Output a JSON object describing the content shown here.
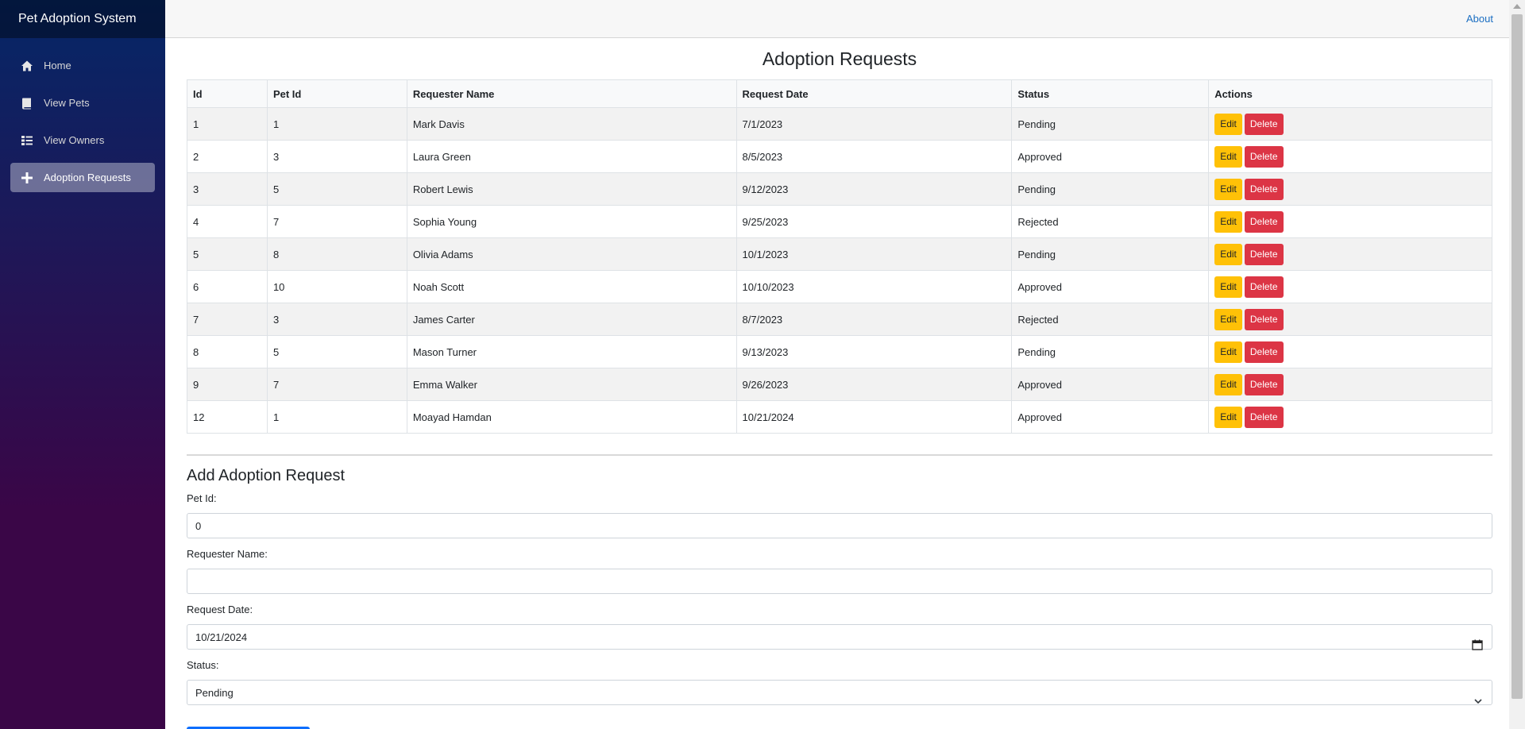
{
  "app": {
    "title": "Pet Adoption System"
  },
  "sidebar": {
    "items": [
      {
        "label": "Home",
        "icon": "home-icon"
      },
      {
        "label": "View Pets",
        "icon": "book-icon"
      },
      {
        "label": "View Owners",
        "icon": "list-icon"
      },
      {
        "label": "Adoption Requests",
        "icon": "plus-icon",
        "active": true
      }
    ]
  },
  "topbar": {
    "about": "About"
  },
  "page": {
    "title": "Adoption Requests"
  },
  "table": {
    "headers": [
      "Id",
      "Pet Id",
      "Requester Name",
      "Request Date",
      "Status",
      "Actions"
    ],
    "rows": [
      {
        "id": "1",
        "pet_id": "1",
        "name": "Mark Davis",
        "date": "7/1/2023",
        "status": "Pending"
      },
      {
        "id": "2",
        "pet_id": "3",
        "name": "Laura Green",
        "date": "8/5/2023",
        "status": "Approved"
      },
      {
        "id": "3",
        "pet_id": "5",
        "name": "Robert Lewis",
        "date": "9/12/2023",
        "status": "Pending"
      },
      {
        "id": "4",
        "pet_id": "7",
        "name": "Sophia Young",
        "date": "9/25/2023",
        "status": "Rejected"
      },
      {
        "id": "5",
        "pet_id": "8",
        "name": "Olivia Adams",
        "date": "10/1/2023",
        "status": "Pending"
      },
      {
        "id": "6",
        "pet_id": "10",
        "name": "Noah Scott",
        "date": "10/10/2023",
        "status": "Approved"
      },
      {
        "id": "7",
        "pet_id": "3",
        "name": "James Carter",
        "date": "8/7/2023",
        "status": "Rejected"
      },
      {
        "id": "8",
        "pet_id": "5",
        "name": "Mason Turner",
        "date": "9/13/2023",
        "status": "Pending"
      },
      {
        "id": "9",
        "pet_id": "7",
        "name": "Emma Walker",
        "date": "9/26/2023",
        "status": "Approved"
      },
      {
        "id": "12",
        "pet_id": "1",
        "name": "Moayad Hamdan",
        "date": "10/21/2024",
        "status": "Approved"
      }
    ],
    "edit_label": "Edit",
    "delete_label": "Delete"
  },
  "form": {
    "title": "Add Adoption Request",
    "pet_id_label": "Pet Id:",
    "pet_id_value": "0",
    "requester_label": "Requester Name:",
    "requester_value": "",
    "date_label": "Request Date:",
    "date_value": "10/21/2024",
    "status_label": "Status:",
    "status_value": "Pending"
  },
  "colors": {
    "sidebar_top": "#052767",
    "sidebar_bottom": "#3a0647",
    "edit": "#ffc107",
    "delete": "#dc3545",
    "link": "#1b6ec2"
  }
}
